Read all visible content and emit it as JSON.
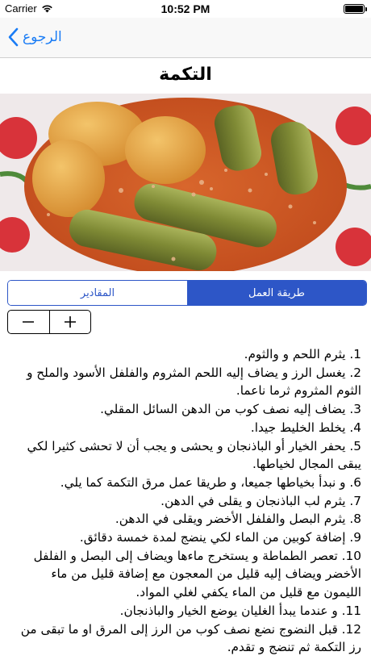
{
  "status_bar": {
    "carrier": "Carrier",
    "time": "10:52 PM"
  },
  "nav": {
    "back_label": "الرجوع"
  },
  "recipe": {
    "title": "التكمة",
    "image_description": "food-photo"
  },
  "tabs": {
    "items": [
      {
        "label": "طريقة العمل",
        "active": true
      },
      {
        "label": "المقادير",
        "active": false
      }
    ]
  },
  "stepper": {
    "minus_label": "−",
    "plus_label": "+"
  },
  "steps": [
    "1. يثرم اللحم و والثوم.",
    "2. يغسل الرز و يضاف إليه اللحم المثروم والفلفل الأسود والملح و الثوم المثروم ثرما ناعما.",
    "3. يضاف إليه نصف كوب من الدهن السائل المقلي.",
    "4. يخلط الخليط جيدا.",
    "5. يحفر الخيار أو الباذنجان و يحشى و يجب أن لا تحشى كثيرا لكي يبقى المجال لخياطها.",
    "6. و نبدأ بخياطها جميعا، و طريقا عمل مرق التكمة كما يلي.",
    "7. يثرم لب الباذنجان و يقلى في الدهن.",
    "8. يثرم البصل والفلفل الأخضر ويقلى في الدهن.",
    "9. إضافة كوبين من الماء لكي ينضج لمدة خمسة دقائق.",
    "10. تعصر الطماطة و يستخرج ماءها ويضاف إلى البصل و الفلفل الأخضر ويضاف إليه قليل من المعجون مع إضافة قليل من ماء الليمون مع قليل من الماء يكفي لغلي المواد.",
    "11. و عندما يبدأ الغليان يوضع الخيار والباذنجان.",
    "12. قبل النضوج نضع نصف كوب من الرز إلى المرق او ما تبقى من رز التكمة ثم تنضج و تقدم."
  ],
  "colors": {
    "accent": "#2d56c7",
    "back_link": "#1a7cf5"
  }
}
